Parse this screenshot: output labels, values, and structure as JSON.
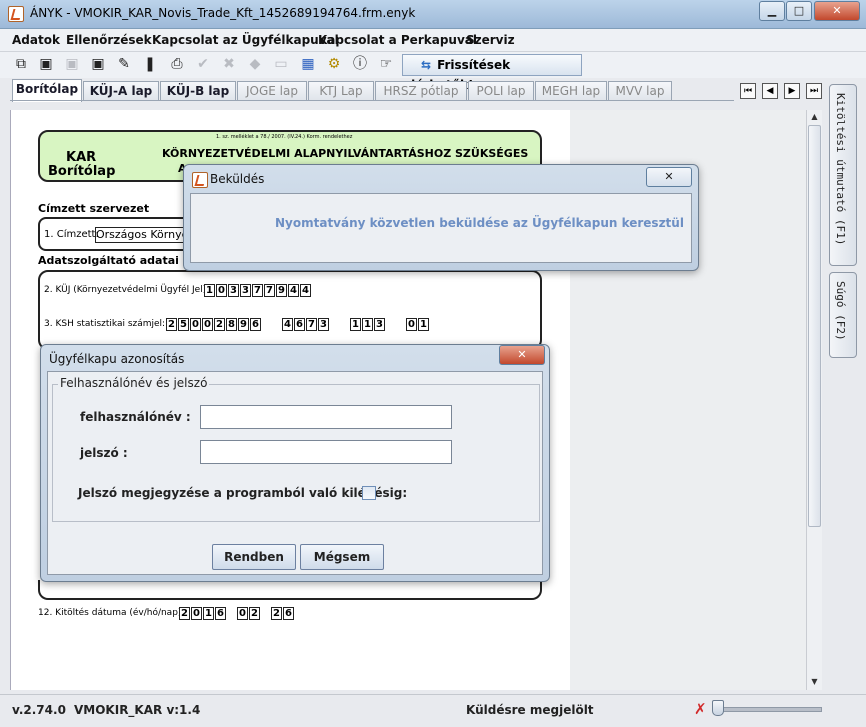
{
  "window": {
    "title": "ÁNYK - VMOKIR_KAR_Novis_Trade_Kft_1452689194764.frm.enyk"
  },
  "menu": [
    "Adatok",
    "Ellenőrzések",
    "Kapcsolat az Ügyfélkapuval",
    "Kapcsolat a Perkapuval",
    "Szerviz"
  ],
  "toolbar": {
    "update_label": "Frissítések elérhetők!"
  },
  "tabs": [
    {
      "label": "Borítólap",
      "enabled": true,
      "selected": true
    },
    {
      "label": "KÜJ-A lap",
      "enabled": true
    },
    {
      "label": "KÜJ-B lap",
      "enabled": true
    },
    {
      "label": "JOGE lap",
      "enabled": false
    },
    {
      "label": "KTJ Lap",
      "enabled": false
    },
    {
      "label": "HRSZ pótlap",
      "enabled": false
    },
    {
      "label": "POLI lap",
      "enabled": false
    },
    {
      "label": "MEGH lap",
      "enabled": false
    },
    {
      "label": "MVV lap",
      "enabled": false
    }
  ],
  "side_tabs": {
    "guide": "Kitöltési útmutató (F1)",
    "help": "Súgó (F2)"
  },
  "form": {
    "decree": "1. sz. melléklet a 78./ 2007. (IV.24.) Korm. rendelethez",
    "kar_title": "KAR",
    "kar_subtitle": "Borítólap",
    "main_title": "KÖRNYEZETVÉDELMI ALAPNYILVÁNTARTÁSHOZ SZÜKSÉGES",
    "main_title_2": "A",
    "recipient_section": "Címzett szervezet",
    "recipient_label": "1. Címzett:",
    "recipient_value": "Országos Környez",
    "provider_section": "Adatszolgáltató adatai",
    "kuj_label": "2. KÜJ (Környezetvédelmi Ügyfél Jel):",
    "kuj_digits": [
      "1",
      "0",
      "3",
      "3",
      "7",
      "7",
      "9",
      "4",
      "4"
    ],
    "ksh_label": "3. KSH statisztikai számjel:",
    "ksh_groups": [
      [
        "2",
        "5",
        "0",
        "0",
        "2",
        "8",
        "9",
        "6"
      ],
      [
        "4",
        "6",
        "7",
        "3"
      ],
      [
        "1",
        "1",
        "3"
      ],
      [
        "0",
        "1"
      ]
    ],
    "date_label": "12. Kitöltés dátuma (év/hó/nap):",
    "date_groups": [
      [
        "2",
        "0",
        "1",
        "6"
      ],
      [
        "0",
        "2"
      ],
      [
        "2",
        "6"
      ]
    ]
  },
  "dialog_send": {
    "title": "Beküldés",
    "message": "Nyomtatvány közvetlen beküldése az Ügyfélkapun keresztül"
  },
  "dialog_login": {
    "title": "Ügyfélkapu azonosítás",
    "group_label": "Felhasználónév és jelszó",
    "username_label": "felhasználónév :",
    "username_value": "",
    "password_label": "jelszó :",
    "password_value": "",
    "remember_label": "Jelszó megjegyzése a programból való kilépésig:",
    "remember_checked": false,
    "ok_label": "Rendben",
    "cancel_label": "Mégsem"
  },
  "status": {
    "version": "v.2.74.0",
    "form_version": "VMOKIR_KAR v:1.4",
    "state": "Küldésre megjelölt"
  }
}
